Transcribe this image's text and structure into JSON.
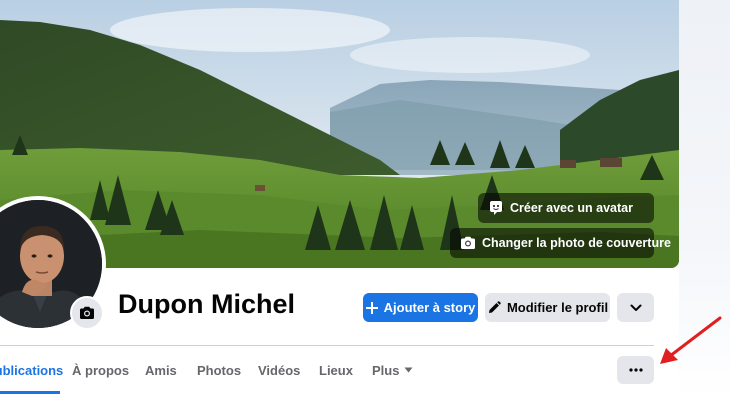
{
  "cover": {
    "create_avatar_label": "Créer avec un avatar",
    "change_cover_label": "Changer la photo de couverture"
  },
  "profile": {
    "name": "Dupon Michel"
  },
  "actions": {
    "add_story_label": "Ajouter à story",
    "edit_profile_label": "Modifier le profil"
  },
  "tabs": [
    {
      "label": "Publications",
      "active": true
    },
    {
      "label": "À propos"
    },
    {
      "label": "Amis"
    },
    {
      "label": "Photos"
    },
    {
      "label": "Vidéos"
    },
    {
      "label": "Lieux"
    },
    {
      "label": "Plus"
    }
  ],
  "colors": {
    "accent": "#1b74e4",
    "annotation_arrow": "#e02020",
    "button_gray": "#e4e6eb"
  },
  "icons": {
    "create_avatar": "avatar-face-icon",
    "change_cover": "camera-icon",
    "add_story": "plus-icon",
    "edit_profile": "pencil-icon",
    "expand": "chevron-down-icon",
    "more": "ellipsis-icon",
    "tab_more": "caret-down-icon"
  }
}
